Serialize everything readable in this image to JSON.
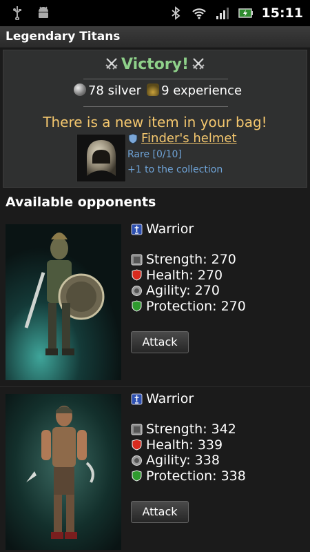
{
  "status_bar": {
    "time": "15:11",
    "icons": [
      "usb-icon",
      "android-debug-icon",
      "bluetooth-icon",
      "wifi-icon",
      "signal-icon",
      "battery-charging-icon"
    ]
  },
  "app": {
    "title": "Legendary Titans"
  },
  "battle_result": {
    "headline": "Victory!",
    "silver_amount": "78 silver",
    "experience_amount": "9 experience",
    "new_item_message": "There is a new item in your bag!",
    "item": {
      "name": "Finder's helmet",
      "rarity": "Rare [0/10]",
      "collection_note": "+1 to the collection"
    }
  },
  "opponents_section": {
    "title": "Available opponents"
  },
  "opponents": [
    {
      "class": "Warrior",
      "strength": "Strength: 270",
      "health": "Health: 270",
      "agility": "Agility: 270",
      "protection": "Protection: 270",
      "attack_label": "Attack"
    },
    {
      "class": "Warrior",
      "strength": "Strength: 342",
      "health": "Health: 339",
      "agility": "Agility: 338",
      "protection": "Protection: 338",
      "attack_label": "Attack"
    }
  ],
  "colors": {
    "victory": "#8fd18a",
    "highlight": "#f4c76e",
    "rarity": "#6fa4d8"
  }
}
